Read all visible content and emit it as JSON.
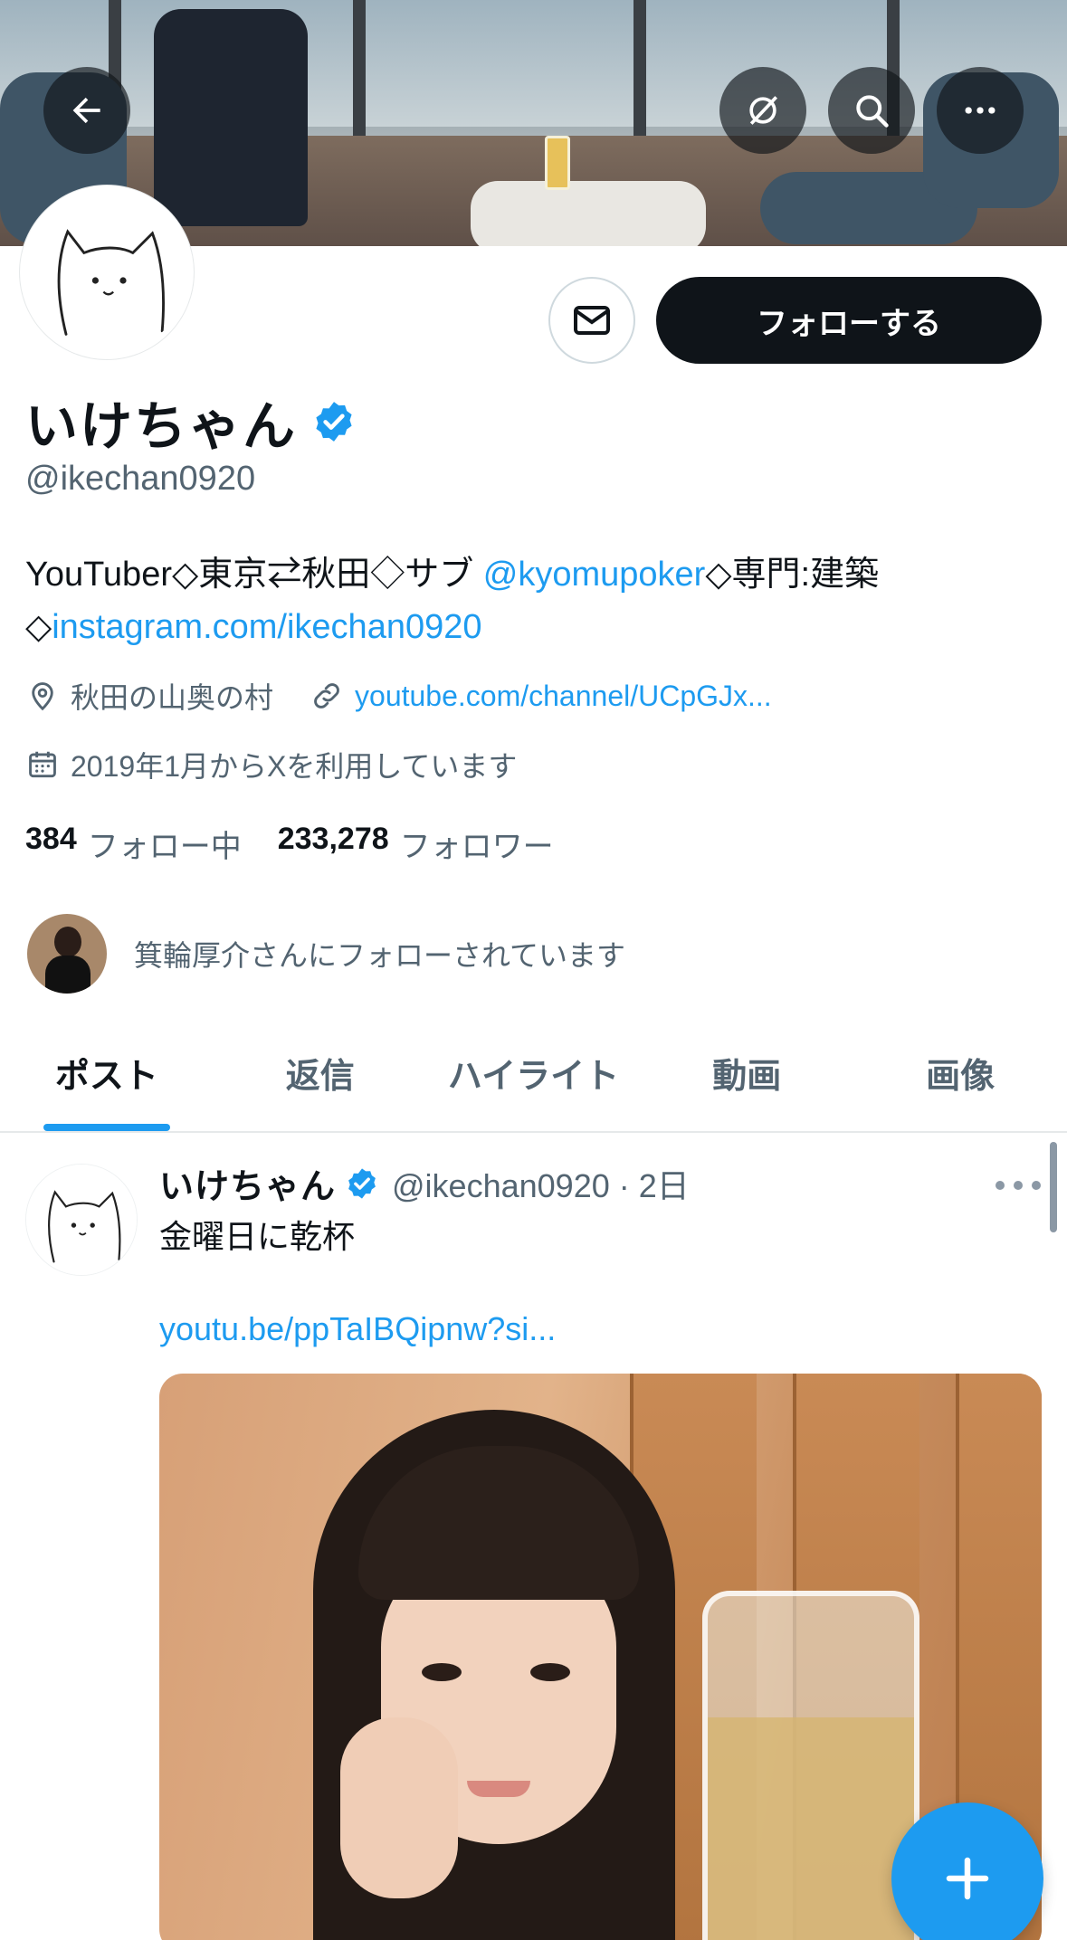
{
  "profile": {
    "display_name": "いけちゃん",
    "handle": "@ikechan0920",
    "bio_text_1": "YouTuber◇東京⇄秋田◇サブ ",
    "bio_mention": "@kyomupoker",
    "bio_text_2": "◇専門:建築",
    "bio_text_3": "◇",
    "bio_link": "instagram.com/ikechan0920",
    "location": "秋田の山奥の村",
    "website": "youtube.com/channel/UCpGJx...",
    "joined": "2019年1月からXを利用しています",
    "following_count": "384",
    "following_label": "フォロー中",
    "followers_count": "233,278",
    "followers_label": "フォロワー",
    "followed_by_text": "箕輪厚介さんにフォローされています"
  },
  "actions": {
    "follow_label": "フォローする"
  },
  "tabs": [
    {
      "label": "ポスト",
      "active": true
    },
    {
      "label": "返信",
      "active": false
    },
    {
      "label": "ハイライト",
      "active": false
    },
    {
      "label": "動画",
      "active": false
    },
    {
      "label": "画像",
      "active": false
    }
  ],
  "post": {
    "name": "いけちゃん",
    "handle_time": "@ikechan0920 · 2日",
    "text": "金曜日に乾杯",
    "link": "youtu.be/ppTaIBQipnw?si..."
  },
  "colors": {
    "accent": "#1d9bf0",
    "text_primary": "#0f1419",
    "text_secondary": "#536471"
  },
  "icons": {
    "back": "arrow-left-icon",
    "grok": "grok-icon",
    "search": "search-icon",
    "more": "more-horizontal-icon",
    "message": "mail-icon",
    "verified": "verified-badge-icon",
    "location": "location-pin-icon",
    "link": "link-icon",
    "calendar": "calendar-icon",
    "compose": "plus-icon"
  }
}
